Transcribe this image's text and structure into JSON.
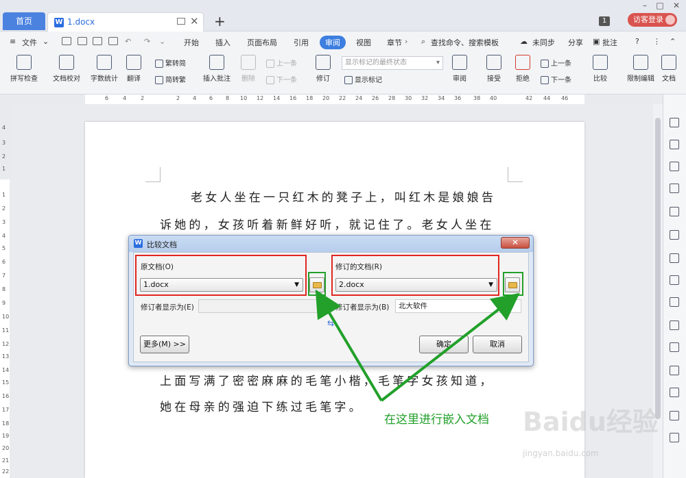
{
  "tabs": {
    "home": "首页",
    "doc": "1.docx"
  },
  "titlebar": {
    "page_count": "1",
    "visitor": "访客登录"
  },
  "menubar": {
    "file": "文件",
    "items": [
      "开始",
      "插入",
      "页面布局",
      "引用",
      "审阅",
      "视图",
      "章节"
    ],
    "active": "审阅",
    "search": "查找命令、搜索模板",
    "sync": "未同步",
    "share": "分享",
    "annotate": "批注"
  },
  "ribbon": {
    "spellcheck": "拼写检查",
    "doc_proof": "文档校对",
    "word_count": "字数统计",
    "translate": "翻译",
    "to_traditional": "繁转简",
    "to_simplified": "简转繁",
    "insert_comment": "插入批注",
    "delete": "删除",
    "prev_comment": "上一条",
    "next_comment": "下一条",
    "revise": "修订",
    "markup_state": "显示标记的最终状态",
    "show_markup": "显示标记",
    "review": "审阅",
    "accept": "接受",
    "reject": "拒绝",
    "prev_change": "上一条",
    "next_change": "下一条",
    "compare": "比较",
    "restrict_edit": "限制编辑",
    "doc_more": "文档"
  },
  "ruler": {
    "h": [
      "6",
      "4",
      "2",
      "2",
      "4",
      "6",
      "8",
      "10",
      "12",
      "14",
      "16",
      "18",
      "20",
      "22",
      "24",
      "26",
      "28",
      "30",
      "32",
      "34",
      "36",
      "38",
      "40",
      "42",
      "44",
      "46"
    ],
    "v": [
      "4",
      "3",
      "2",
      "1",
      "1",
      "2",
      "3",
      "4",
      "5",
      "6",
      "7",
      "8",
      "9",
      "10",
      "11",
      "12",
      "13",
      "14",
      "15",
      "16",
      "17",
      "18",
      "19",
      "20",
      "21",
      "22"
    ]
  },
  "document": {
    "lines": [
      "老女人坐在一只红木的凳子上，叫红木是娘娘告",
      "诉她的，女孩听着新鲜好听，就记住了。老女人坐在",
      "上面写满了密密麻麻的毛笔小楷，毛笔字女孩知道，",
      "她在母亲的强迫下练过毛笔字。"
    ]
  },
  "dialog": {
    "title": "比较文档",
    "original_label": "原文档(O)",
    "original_value": "1.docx",
    "revised_label": "修订的文档(R)",
    "revised_value": "2.docx",
    "reviser_label_left": "修订者显示为(E)",
    "reviser_label_right": "修订者显示为(B)",
    "reviser_value_right": "北大软件",
    "more_button": "更多(M) >>",
    "ok_button": "确定",
    "cancel_button": "取消"
  },
  "annotation": {
    "text": "在这里进行嵌入文档",
    "color": "#22a02a",
    "box_red": "#e0261f"
  },
  "watermark": {
    "brand": "Baidu经验",
    "url": "jingyan.baidu.com"
  }
}
